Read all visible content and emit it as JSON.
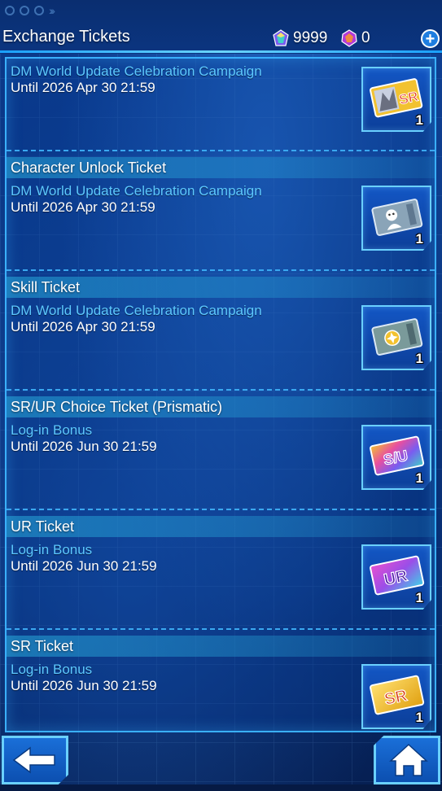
{
  "header": {
    "title": "Exchange Tickets",
    "gems": "9999",
    "special_gems": "0",
    "add_label": "+"
  },
  "entries": [
    {
      "header": "",
      "source": "DM World Update Celebration Campaign",
      "until": "Until 2026 Apr 30 21:59",
      "ticket_icon": "sr-ticket-art-icon",
      "ticket_label": "SR",
      "count": "1"
    },
    {
      "header": "Character Unlock Ticket",
      "source": "DM World Update Celebration Campaign",
      "until": "Until 2026 Apr 30 21:59",
      "ticket_icon": "character-ticket-icon",
      "ticket_label": "",
      "count": "1"
    },
    {
      "header": "Skill Ticket",
      "source": "DM World Update Celebration Campaign",
      "until": "Until 2026 Apr 30 21:59",
      "ticket_icon": "skill-ticket-icon",
      "ticket_label": "",
      "count": "1"
    },
    {
      "header": "SR/UR Choice Ticket (Prismatic)",
      "source": "Log-in Bonus",
      "until": "Until 2026 Jun 30 21:59",
      "ticket_icon": "sr-ur-choice-ticket-icon",
      "ticket_label": "S/U",
      "count": "1"
    },
    {
      "header": "UR Ticket",
      "source": "Log-in Bonus",
      "until": "Until 2026 Jun 30 21:59",
      "ticket_icon": "ur-ticket-icon",
      "ticket_label": "UR",
      "count": "1"
    },
    {
      "header": "SR Ticket",
      "source": "Log-in Bonus",
      "until": "Until 2026 Jun 30 21:59",
      "ticket_icon": "sr-ticket-icon",
      "ticket_label": "SR",
      "count": "1"
    }
  ],
  "footer": {
    "back_icon": "back-arrow-icon",
    "home_icon": "home-icon"
  },
  "colors": {
    "accent": "#3ab0ff",
    "source_text": "#5cc8ff",
    "ticket_gold": "#f2c230",
    "ticket_purple": "#9a4ee8"
  }
}
